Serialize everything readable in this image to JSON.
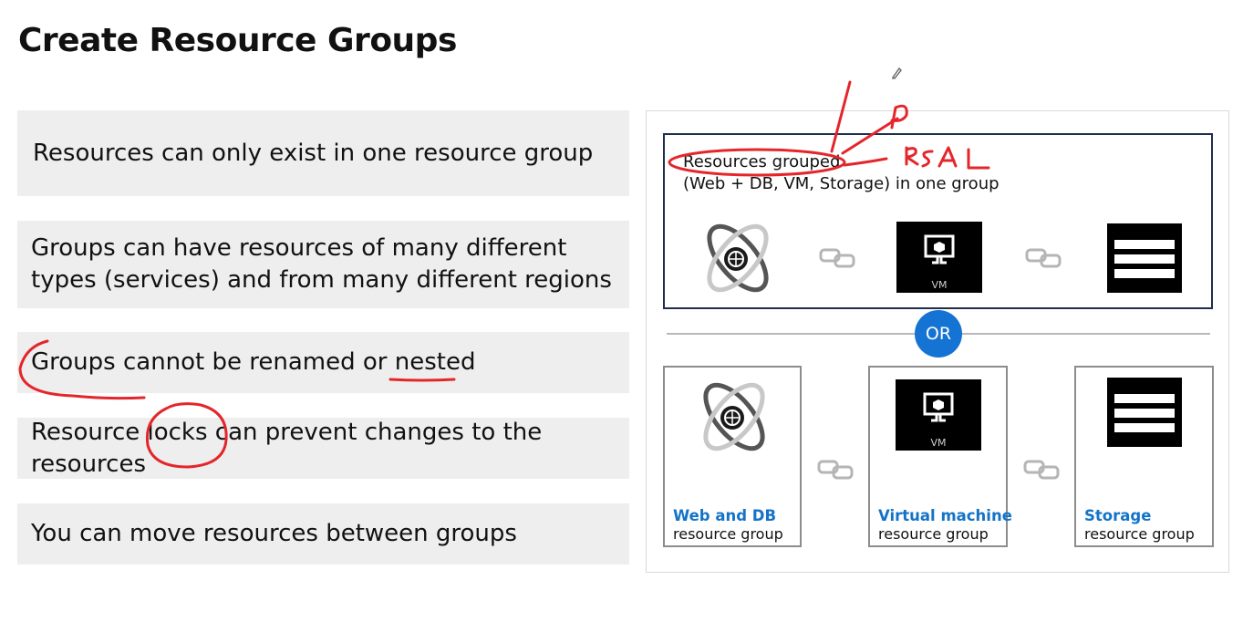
{
  "slide": {
    "title": "Create Resource Groups",
    "bullets": [
      "Resources can only exist in one resource group",
      "Groups can have resources of many different types (services) and from many different regions",
      "Groups cannot be renamed or nested",
      "Resource locks can prevent changes to the resources",
      "You can move resources between groups"
    ]
  },
  "diagram": {
    "grouped_line1": "Resources grouped",
    "grouped_line2": "(Web + DB, VM, Storage) in one group",
    "or_label": "OR",
    "vm_tile_label": "VM",
    "resource_groups": [
      {
        "name": "Web and DB",
        "subtitle": "resource group"
      },
      {
        "name": "Virtual machine",
        "subtitle": "resource group"
      },
      {
        "name": "Storage",
        "subtitle": "resource group"
      }
    ]
  },
  "annotations": {
    "handwritten_text": "RBAC",
    "handwritten_letter": "P",
    "ink_color": "#e4262b"
  },
  "icons": [
    "web-db-orbit-icon",
    "link-icon",
    "vm-icon",
    "storage-table-icon",
    "pencil-cursor-icon"
  ],
  "colors": {
    "accent": "#1473d3",
    "group_border": "#1f2d4f",
    "bullet_bg": "#eeeeee"
  }
}
